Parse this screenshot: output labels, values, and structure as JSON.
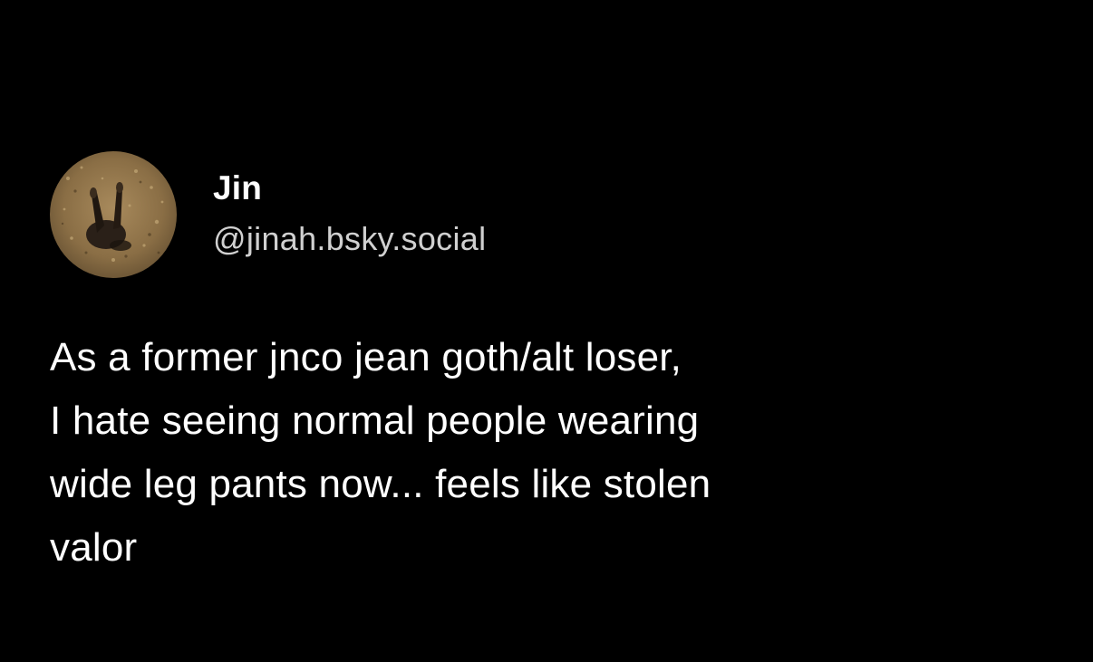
{
  "post": {
    "author": {
      "display_name": "Jin",
      "handle": "@jinah.bsky.social",
      "avatar_icon": "avatar-photo-icon"
    },
    "body_lines": [
      "As a former jnco jean goth/alt loser,",
      "I hate seeing normal people wearing",
      "wide leg pants now... feels like stolen",
      "valor"
    ]
  },
  "colors": {
    "background": "#000000",
    "name_text": "#ffffff",
    "handle_text": "#d0d0d0",
    "body_text": "#ffffff"
  }
}
